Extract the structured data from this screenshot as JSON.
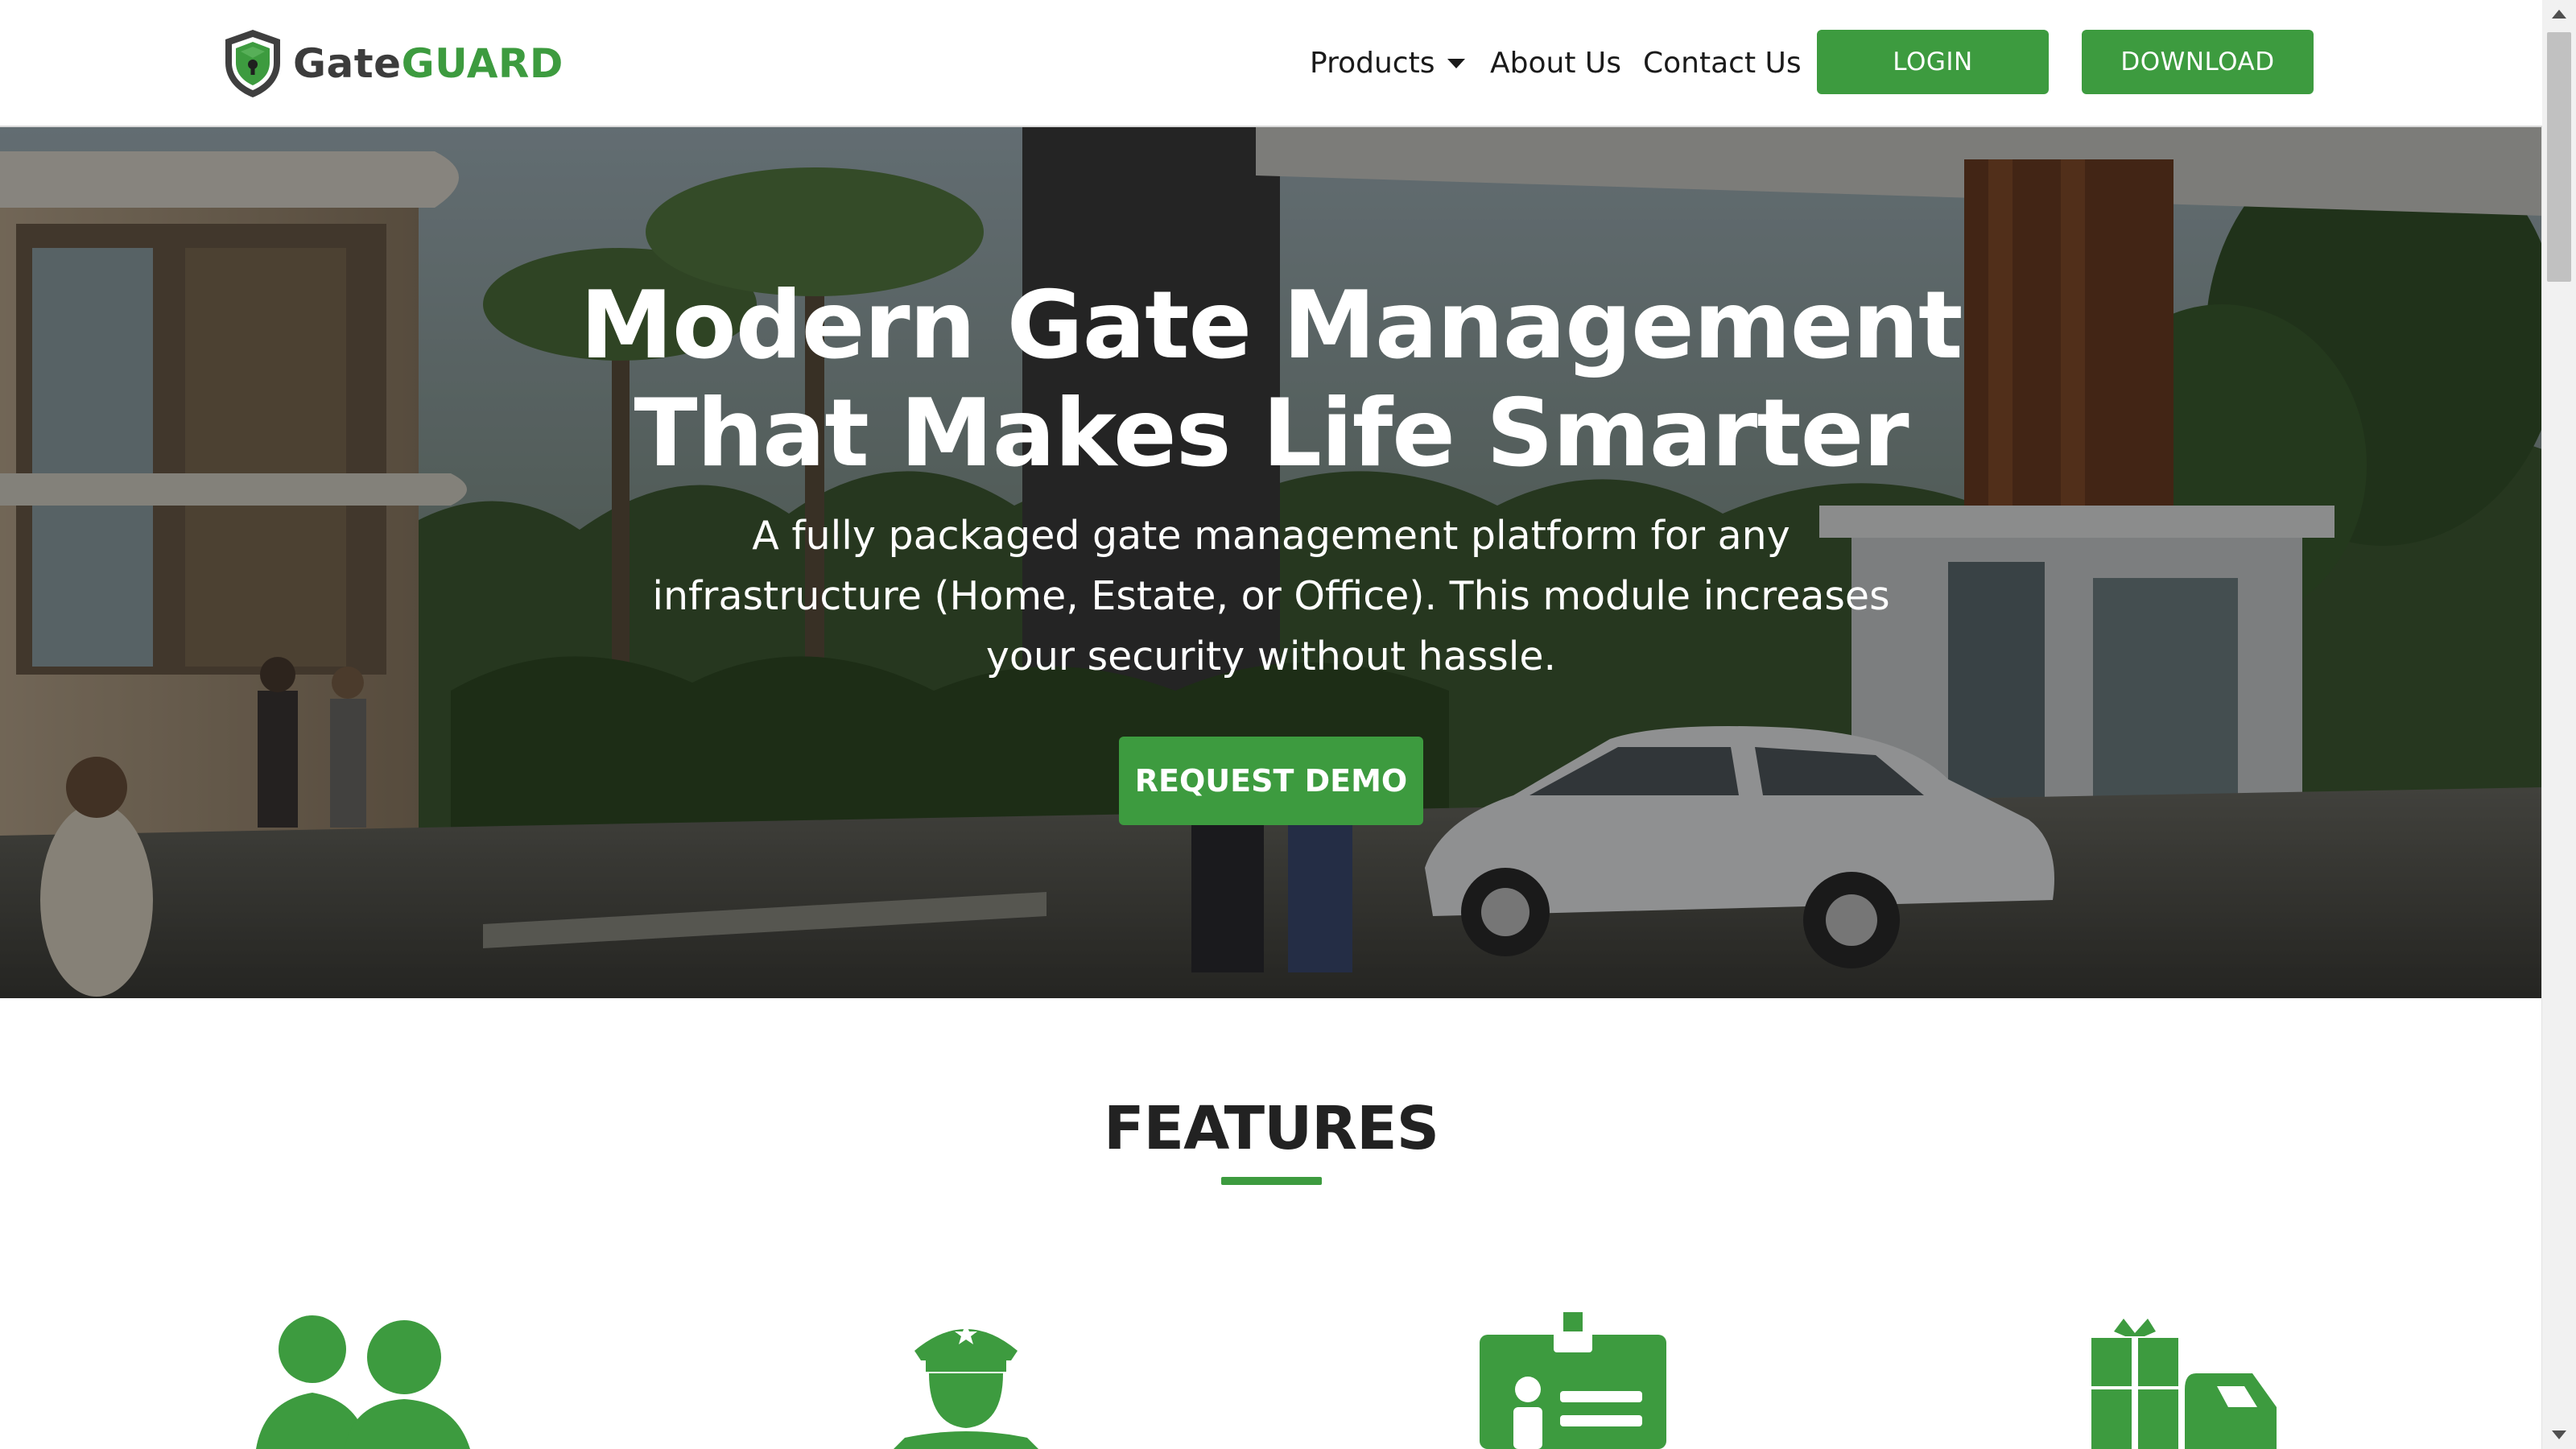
{
  "brand": {
    "name_part1": "Gate",
    "name_part2": "GUARD",
    "accent_color": "#3d9b3f",
    "logo_icon": "shield-lock-icon"
  },
  "nav": {
    "items": [
      {
        "label": "Products",
        "has_dropdown": true
      },
      {
        "label": "About Us"
      },
      {
        "label": "Contact Us"
      }
    ],
    "login_label": "LOGIN",
    "download_label": "DOWNLOAD"
  },
  "hero": {
    "title_line1": "Modern Gate Management",
    "title_line2": "That Makes Life Smarter",
    "subtitle": "A fully packaged gate management platform for any infrastructure (Home, Estate, or Office). This module increases your security without hassle.",
    "cta_label": "REQUEST DEMO"
  },
  "features": {
    "title": "FEATURES",
    "icons": [
      "residents-icon",
      "security-guard-icon",
      "id-badge-icon",
      "delivery-truck-icon"
    ]
  },
  "scrollbar": {
    "position_fraction": 0.0
  }
}
